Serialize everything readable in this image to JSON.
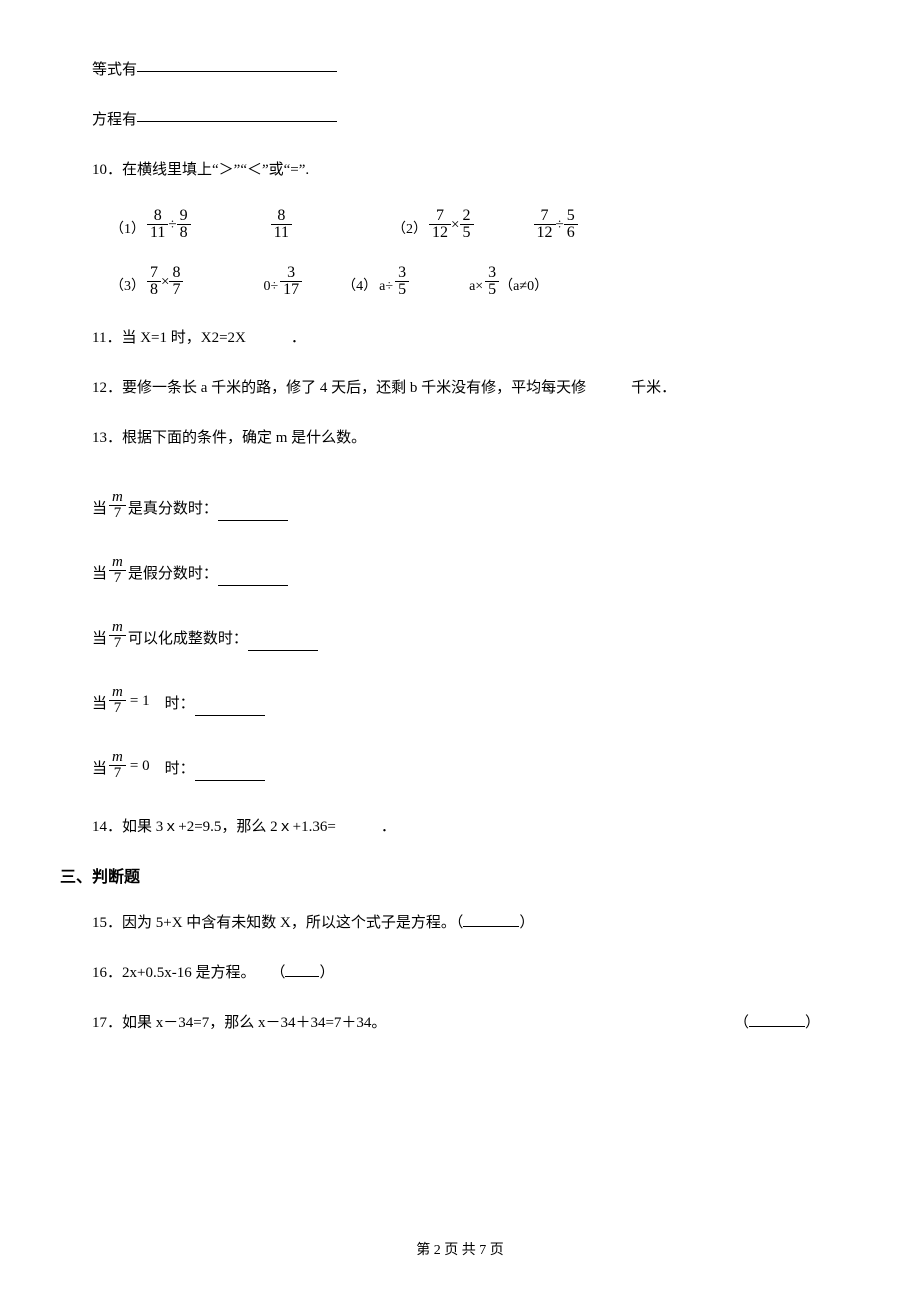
{
  "q_eq_prefix": "等式有",
  "q_fang_prefix": "方程有",
  "q10_num": "10",
  "q10_text": "．在横线里填上“＞”“＜”或“=”.",
  "q10_r1_idx1": "（1）",
  "q10_r1_a_n": "8",
  "q10_r1_a_d": "11",
  "q10_r1_a_op": "÷",
  "q10_r1_b_n": "9",
  "q10_r1_b_d": "8",
  "q10_r1_c_n": "8",
  "q10_r1_c_d": "11",
  "q10_r1_idx2": "（2）",
  "q10_r1_d_n": "7",
  "q10_r1_d_d": "12",
  "q10_r1_d_op": "×",
  "q10_r1_e_n": "2",
  "q10_r1_e_d": "5",
  "q10_r1_f_n": "7",
  "q10_r1_f_d": "12",
  "q10_r1_f_op": "÷",
  "q10_r1_g_n": "5",
  "q10_r1_g_d": "6",
  "q10_r2_idx3": "（3）",
  "q10_r2_a_n": "7",
  "q10_r2_a_d": "8",
  "q10_r2_a_op": "×",
  "q10_r2_b_n": "8",
  "q10_r2_b_d": "7",
  "q10_r2_c_pre": "0÷",
  "q10_r2_c_n": "3",
  "q10_r2_c_d": "17",
  "q10_r2_idx4": "（4）",
  "q10_r2_d_pre": "a÷",
  "q10_r2_d_n": "3",
  "q10_r2_d_d": "5",
  "q10_r2_e_pre": "a×",
  "q10_r2_e_n": "3",
  "q10_r2_e_d": "5",
  "q10_r2_e_post": "（a≠0）",
  "q11_num": "11",
  "q11_text": "．当 X=1 时，X2=2X   ．",
  "q12_num": "12",
  "q12_text": "．要修一条长 a 千米的路，修了 4 天后，还剩 b 千米没有修，平均每天修   千米．",
  "q13_num": "13",
  "q13_text": "．根据下面的条件，确定 m 是什么数。",
  "q13_pre_dang": "当",
  "q13_m": "m",
  "q13_7": "7",
  "q13_true_suffix": " 是真分数时：",
  "q13_false_suffix": " 是假分数时：",
  "q13_int_suffix": " 可以化成整数时：",
  "q13_eq1": "= 1",
  "q13_eq1_suffix": " 时：",
  "q13_eq0": "= 0",
  "q13_eq0_suffix": " 时：",
  "q14_num": "14",
  "q14_text": "．如果 3ｘ+2=9.5，那么 2ｘ+1.36=   ．",
  "sec3": "三、判断题",
  "q15_num": "15",
  "q15_text": "．因为 5+X 中含有未知数 X，所以这个式子是方程。（",
  "q15_close": "）",
  "q16_num": "16",
  "q16_text": "．2x+0.5x-16 是方程。 （",
  "q16_close": "）",
  "q17_num": "17",
  "q17_text": "．如果 x－34=7，那么 x－34＋34=7＋34。",
  "q17_paren_open": "（",
  "q17_paren_close": "）",
  "footer": "第 2 页 共 7 页"
}
